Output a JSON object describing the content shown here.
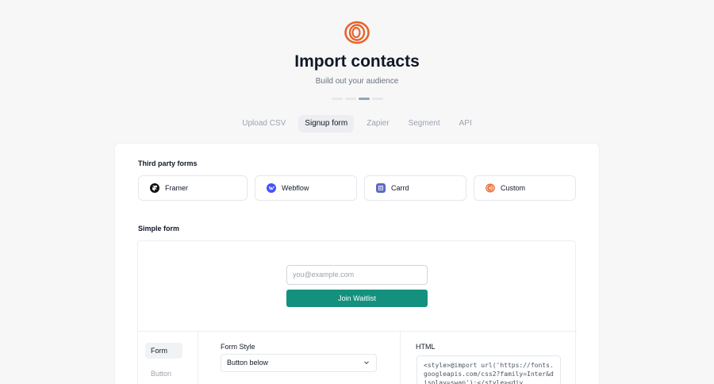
{
  "header": {
    "title": "Import contacts",
    "subtitle": "Build out your audience"
  },
  "progress": {
    "steps": 4,
    "current_step": 3
  },
  "tabs": [
    {
      "label": "Upload CSV",
      "active": false
    },
    {
      "label": "Signup form",
      "active": true
    },
    {
      "label": "Zapier",
      "active": false
    },
    {
      "label": "Segment",
      "active": false
    },
    {
      "label": "API",
      "active": false
    }
  ],
  "third_party": {
    "label": "Third party forms",
    "options": [
      {
        "label": "Framer",
        "icon": "framer-icon"
      },
      {
        "label": "Webflow",
        "icon": "webflow-icon"
      },
      {
        "label": "Carrd",
        "icon": "carrd-icon"
      },
      {
        "label": "Custom",
        "icon": "custom-icon"
      }
    ]
  },
  "simple_form": {
    "label": "Simple form",
    "preview": {
      "email_placeholder": "you@example.com",
      "button_label": "Join Waitlist"
    },
    "side_nav": [
      {
        "label": "Form",
        "active": true
      },
      {
        "label": "Button",
        "active": false
      }
    ],
    "form_style": {
      "label": "Form Style",
      "value": "Button below"
    },
    "html": {
      "label": "HTML",
      "code": "<style>@import url('https://fonts.googleapis.com/css2?family=Inter&display=swap');</style><div"
    }
  },
  "colors": {
    "brand_orange": "#e8632b",
    "primary_button": "#14917e",
    "framer": "#111111",
    "webflow": "#4353ff",
    "carrd": "#5b6bbf"
  }
}
